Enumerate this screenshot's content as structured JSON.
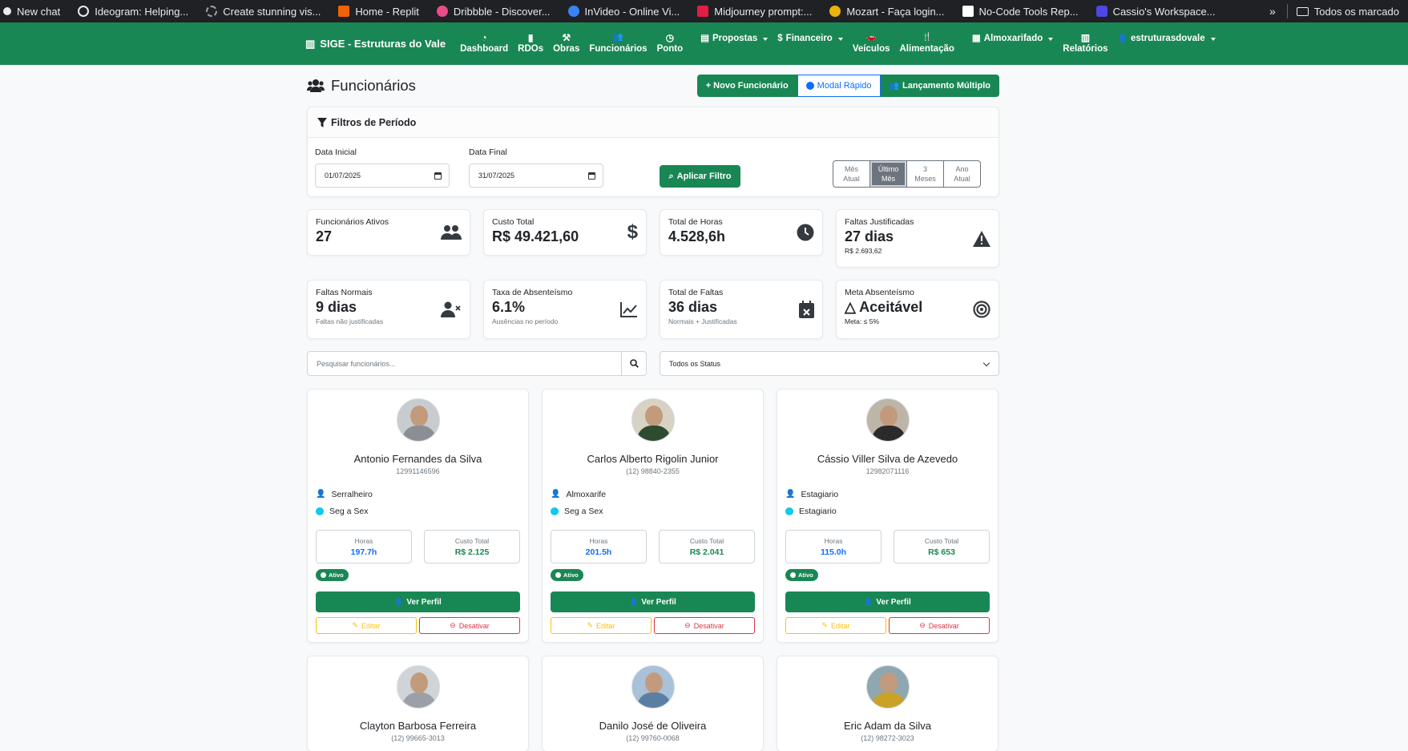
{
  "bookmarks": {
    "items": [
      {
        "label": "New chat",
        "color": "#e8eaed"
      },
      {
        "label": "Ideogram: Helping...",
        "color": "#e8eaed"
      },
      {
        "label": "Create stunning vis...",
        "color": "#9aa0a6"
      },
      {
        "label": "Home - Replit",
        "color": "#f26207"
      },
      {
        "label": "Dribbble - Discover...",
        "color": "#ea4c89"
      },
      {
        "label": "InVideo - Online Vi...",
        "color": "#3b82f6"
      },
      {
        "label": "Midjourney prompt:...",
        "color": "#e11d48"
      },
      {
        "label": "Mozart - Faça login...",
        "color": "#eab308"
      },
      {
        "label": "No-Code Tools Rep...",
        "color": "#ffffff"
      },
      {
        "label": "Cassio's Workspace...",
        "color": "#4f46e5"
      }
    ],
    "more": "»",
    "all_bookmarks": "Todos os marcado"
  },
  "navbar": {
    "brand": "SIGE - Estruturas do Vale",
    "items": [
      {
        "label": "Dashboard",
        "icon": "◔"
      },
      {
        "label": "RDOs",
        "icon": "▮"
      },
      {
        "label": "Obras",
        "icon": "⚒"
      },
      {
        "label": "Funcionários",
        "icon": "👥"
      },
      {
        "label": "Ponto",
        "icon": "◷"
      }
    ],
    "dropdowns": [
      {
        "label": "Propostas",
        "icon": "▤"
      },
      {
        "label": "Financeiro",
        "icon": "$"
      }
    ],
    "items2": [
      {
        "label": "Veículos",
        "icon": "🚗"
      },
      {
        "label": "Alimentação",
        "icon": "🍴"
      }
    ],
    "almoxarifado": {
      "label": "Almoxarifado",
      "icon": "▦"
    },
    "relatorios": {
      "label": "Relatórios",
      "icon": "▥"
    },
    "user": {
      "label": "estruturasdovale",
      "icon": "👤"
    }
  },
  "page": {
    "title": "Funcionários",
    "buttons": {
      "novo": "+ Novo Funcionário",
      "modal": "Modal Rápido",
      "lancamento": "Lançamento Múltiplo"
    }
  },
  "filters": {
    "title": "Filtros de Período",
    "data_inicial_label": "Data Inicial",
    "data_inicial_value": "01/07/2025",
    "data_final_label": "Data Final",
    "data_final_value": "31/07/2025",
    "apply": "Aplicar Filtro",
    "periods": [
      {
        "l1": "Mês",
        "l2": "Atual"
      },
      {
        "l1": "Último",
        "l2": "Mês"
      },
      {
        "l1": "3",
        "l2": "Meses"
      },
      {
        "l1": "Ano",
        "l2": "Atual"
      }
    ],
    "active_period": 1
  },
  "stats_row1": [
    {
      "label": "Funcionários Ativos",
      "value": "27",
      "sub": "",
      "icon": "users-icon"
    },
    {
      "label": "Custo Total",
      "value": "R$ 49.421,60",
      "sub": "",
      "icon": "dollar-icon"
    },
    {
      "label": "Total de Horas",
      "value": "4.528,6h",
      "sub": "",
      "icon": "clock-icon"
    },
    {
      "label": "Faltas Justificadas",
      "value": "27 dias",
      "sub": "R$ 2.693,62",
      "icon": "warning-icon"
    }
  ],
  "stats_row2": [
    {
      "label": "Faltas Normais",
      "value": "9 dias",
      "sub": "Faltas não justificadas",
      "icon": "user-x-icon"
    },
    {
      "label": "Taxa de Absenteísmo",
      "value": "6.1%",
      "sub": "Ausências no período",
      "icon": "chart-line-icon"
    },
    {
      "label": "Total de Faltas",
      "value": "36 dias",
      "sub": "Normais + Justificadas",
      "icon": "calendar-x-icon"
    },
    {
      "label": "Meta Absenteísmo",
      "value": "△ Aceitável",
      "sub": "Meta: ≤ 5%",
      "icon": "target-icon"
    }
  ],
  "search": {
    "placeholder": "Pesquisar funcionários...",
    "status": "Todos os Status"
  },
  "employees": [
    {
      "name": "Antonio Fernandes da Silva",
      "phone": "12991146596",
      "role": "Serralheiro",
      "schedule": "Seg a Sex",
      "hours_label": "Horas",
      "hours": "197.7h",
      "cost_label": "Custo Total",
      "cost": "R$ 2.125",
      "status": "Ativo",
      "shirt": "#8a8f96",
      "ver": "Ver Perfil",
      "editar": "Editar",
      "desativar": "Desativar"
    },
    {
      "name": "Carlos Alberto Rigolin Junior",
      "phone": "(12) 98840-2355",
      "role": "Almoxarife",
      "schedule": "Seg a Sex",
      "hours_label": "Horas",
      "hours": "201.5h",
      "cost_label": "Custo Total",
      "cost": "R$ 2.041",
      "status": "Ativo",
      "shirt": "#2e4a2f",
      "ver": "Ver Perfil",
      "editar": "Editar",
      "desativar": "Desativar"
    },
    {
      "name": "Cássio Viller Silva de Azevedo",
      "phone": "12982071116",
      "role": "Estagiario",
      "schedule": "Estagiario",
      "hours_label": "Horas",
      "hours": "115.0h",
      "cost_label": "Custo Total",
      "cost": "R$ 653",
      "status": "Ativo",
      "shirt": "#2b2b2b",
      "ver": "Ver Perfil",
      "editar": "Editar",
      "desativar": "Desativar"
    },
    {
      "name": "Clayton Barbosa Ferreira",
      "phone": "(12) 99665-3013",
      "shirt": "#9aa0a6"
    },
    {
      "name": "Danilo José de Oliveira",
      "phone": "(12) 99760-0068",
      "shirt": "#5b7fa3"
    },
    {
      "name": "Eric Adam da Silva",
      "phone": "(12) 98272-3023",
      "shirt": "#c9a227"
    }
  ]
}
